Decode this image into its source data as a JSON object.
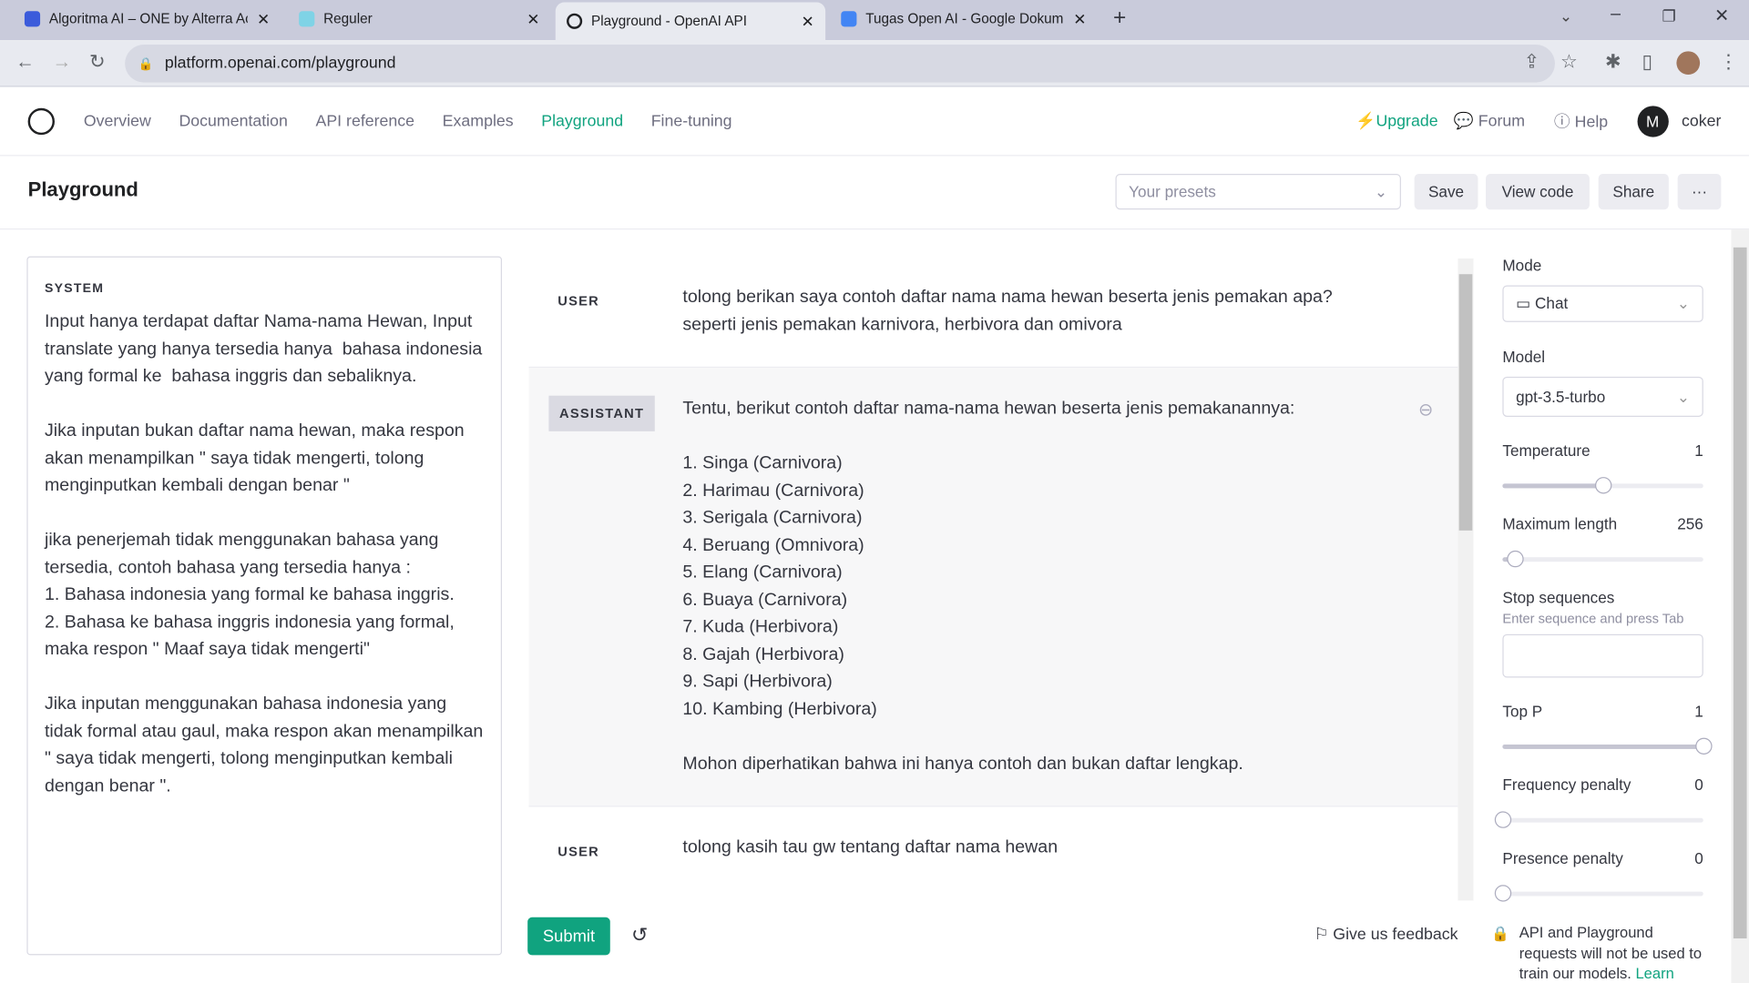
{
  "browser": {
    "tabs": [
      {
        "title": "Algoritma AI – ONE by Alterra Ac",
        "active": false
      },
      {
        "title": "Reguler",
        "active": false
      },
      {
        "title": "Playground - OpenAI API",
        "active": true
      },
      {
        "title": "Tugas Open AI - Google Dokum",
        "active": false
      }
    ],
    "url": "platform.openai.com/playground"
  },
  "nav": {
    "links": [
      "Overview",
      "Documentation",
      "API reference",
      "Examples",
      "Playground",
      "Fine-tuning"
    ],
    "active": "Playground",
    "upgrade": "Upgrade",
    "forum": "Forum",
    "help": "Help",
    "user_initial": "M",
    "user_name": "coker"
  },
  "header": {
    "title": "Playground",
    "presets_placeholder": "Your presets",
    "save": "Save",
    "view_code": "View code",
    "share": "Share",
    "more": "···"
  },
  "system": {
    "label": "SYSTEM",
    "text": "Input hanya terdapat daftar Nama-nama Hewan, Input translate yang hanya tersedia hanya  bahasa indonesia yang formal ke  bahasa inggris dan sebaliknya.\n\nJika inputan bukan daftar nama hewan, maka respon akan menampilkan \" saya tidak mengerti, tolong menginputkan kembali dengan benar \"\n\njika penerjemah tidak menggunakan bahasa yang tersedia, contoh bahasa yang tersedia hanya :\n1. Bahasa indonesia yang formal ke bahasa inggris.\n2. Bahasa ke bahasa inggris indonesia yang formal, maka respon \" Maaf saya tidak mengerti\"\n\nJika inputan menggunakan bahasa indonesia yang tidak formal atau gaul, maka respon akan menampilkan \" saya tidak mengerti, tolong menginputkan kembali dengan benar \"."
  },
  "messages": [
    {
      "role": "USER",
      "text": "tolong berikan saya contoh daftar nama nama hewan beserta jenis pemakan apa? seperti jenis pemakan karnivora, herbivora dan omivora"
    },
    {
      "role": "ASSISTANT",
      "text": "Tentu, berikut contoh daftar nama-nama hewan beserta jenis pemakanannya:\n\n1. Singa (Carnivora)\n2. Harimau (Carnivora)\n3. Serigala (Carnivora)\n4. Beruang (Omnivora)\n5. Elang (Carnivora)\n6. Buaya (Carnivora)\n7. Kuda (Herbivora)\n8. Gajah (Herbivora)\n9. Sapi (Herbivora)\n10. Kambing (Herbivora)\n\nMohon diperhatikan bahwa ini hanya contoh dan bukan daftar lengkap."
    },
    {
      "role": "USER",
      "text": "tolong kasih tau gw tentang daftar nama hewan"
    }
  ],
  "footer": {
    "submit": "Submit",
    "feedback": "Give us feedback",
    "privacy": "API and Playground requests will not be used to train our models.",
    "learn": "Learn"
  },
  "settings": {
    "mode_label": "Mode",
    "mode": "Chat",
    "model_label": "Model",
    "model": "gpt-3.5-turbo",
    "temperature_label": "Temperature",
    "temperature": "1",
    "temperature_frac": 0.5,
    "max_length_label": "Maximum length",
    "max_length": "256",
    "max_length_frac": 0.06,
    "stop_label": "Stop sequences",
    "stop_hint": "Enter sequence and press Tab",
    "top_p_label": "Top P",
    "top_p": "1",
    "top_p_frac": 1.0,
    "freq_label": "Frequency penalty",
    "freq": "0",
    "freq_frac": 0,
    "presence_label": "Presence penalty",
    "presence": "0",
    "presence_frac": 0
  },
  "colors": {
    "accent": "#10a37f"
  }
}
